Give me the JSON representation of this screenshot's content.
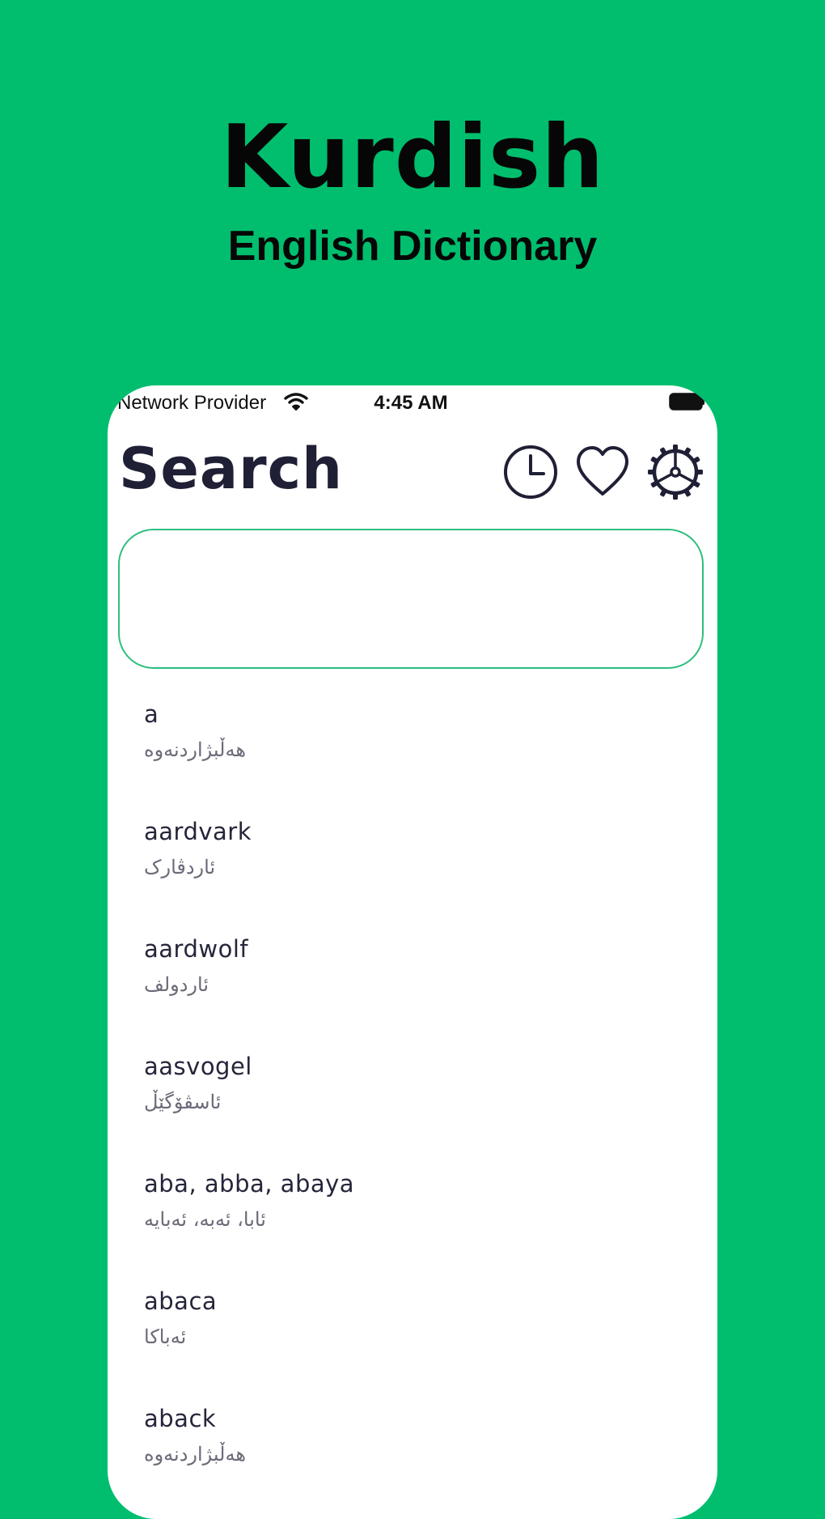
{
  "promo": {
    "title": "Kurdish",
    "subtitle": "English Dictionary"
  },
  "status_bar": {
    "carrier": "Network Provider",
    "time": "4:45 AM"
  },
  "header": {
    "title": "Search",
    "icons": [
      "history-icon",
      "heart-icon",
      "settings-icon"
    ]
  },
  "search": {
    "value": "",
    "placeholder": ""
  },
  "words": [
    {
      "term": "a",
      "translation": "هەڵبژاردنەوە"
    },
    {
      "term": "aardvark",
      "translation": "ئاردڤارک"
    },
    {
      "term": "aardwolf",
      "translation": "ئاردولف"
    },
    {
      "term": "aasvogel",
      "translation": "ئاسڤۆگێڵ"
    },
    {
      "term": "aba, abba, abaya",
      "translation": "ئابا، ئەبە، ئەبایە"
    },
    {
      "term": "abaca",
      "translation": "ئەباکا"
    },
    {
      "term": "aback",
      "translation": "هەڵبژاردنەوە"
    }
  ],
  "colors": {
    "background": "#00BE6E",
    "accent": "#2DBE7E",
    "title": "#1F1F36"
  }
}
